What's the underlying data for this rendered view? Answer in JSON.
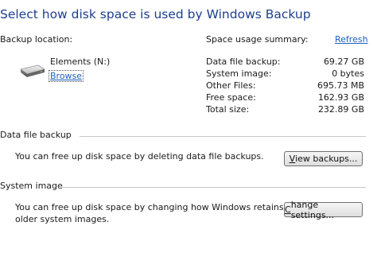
{
  "page": {
    "title": "Select how disk space is used by Windows Backup"
  },
  "backup_location": {
    "label": "Backup location:",
    "drive_name": "Elements (N:)",
    "browse_label": "Browse"
  },
  "summary": {
    "label": "Space usage summary:",
    "refresh_label": "Refresh",
    "rows": [
      {
        "label": "Data file backup:",
        "value": "69.27 GB"
      },
      {
        "label": "System image:",
        "value": "0 bytes"
      },
      {
        "label": "Other Files:",
        "value": "695.73 MB"
      },
      {
        "label": "Free space:",
        "value": "162.93 GB"
      },
      {
        "label": "Total size:",
        "value": "232.89 GB"
      }
    ]
  },
  "data_file_backup": {
    "heading": "Data file backup",
    "description": "You can free up disk space by deleting data file backups.",
    "button_prefix": "",
    "button_accel": "V",
    "button_suffix": "iew backups..."
  },
  "system_image": {
    "heading": "System image",
    "description_line1": "You can free up disk space by changing how Windows retains",
    "description_line2": "older system images.",
    "button_prefix": "",
    "button_accel": "C",
    "button_suffix": "hange settings..."
  },
  "colors": {
    "title": "#1e3f8f",
    "link": "#1f5fbf",
    "separator": "#c8c8c8"
  },
  "icons": {
    "drive": "external-drive-icon"
  }
}
